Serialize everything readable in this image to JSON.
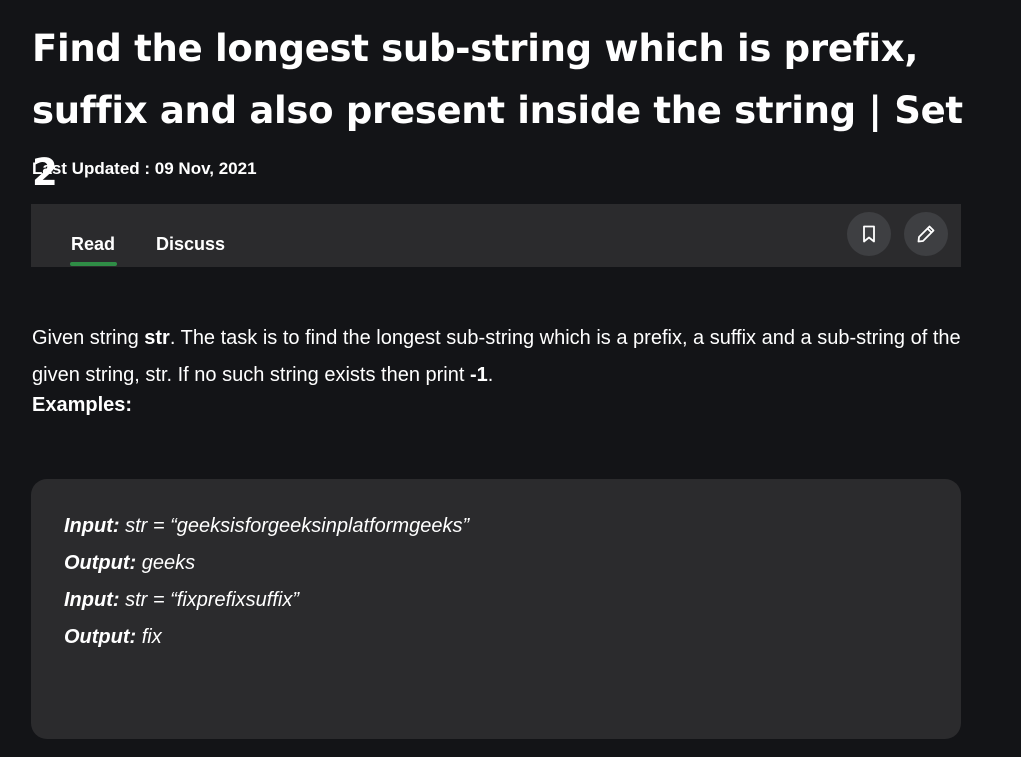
{
  "article": {
    "title": "Find the longest sub-string which is prefix, suffix and also present inside the string | Set 2",
    "last_updated": "Last Updated : 09 Nov, 2021"
  },
  "tabs": {
    "read": "Read",
    "discuss": "Discuss",
    "active": "Read"
  },
  "actions": {
    "bookmark_icon": "bookmark-icon",
    "edit_icon": "pencil-icon"
  },
  "content": {
    "intro_before": "Given string ",
    "intro_var": "str",
    "intro_middle": ". The task is to find the longest sub-string which is a prefix, a suffix and a sub-string of the given string, str. If no such string exists then print ",
    "intro_value": "-1",
    "intro_after": ".",
    "examples_heading": "Examples:"
  },
  "examples": [
    {
      "label": "Input:",
      "value": " str = “geeksisforgeeksinplatformgeeks”"
    },
    {
      "label": "Output:",
      "value": " geeks"
    },
    {
      "label": "Input:",
      "value": " str = “fixprefixsuffix”"
    },
    {
      "label": "Output:",
      "value": " fix"
    }
  ],
  "colors": {
    "background": "#131417",
    "panel": "#2b2b2d",
    "accent": "#2f8d46",
    "icon_button": "#3e3f42"
  }
}
